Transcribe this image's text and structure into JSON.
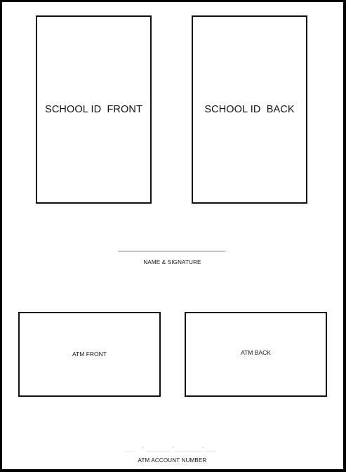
{
  "id_section": {
    "front_label": "SCHOOL ID  FRONT",
    "back_label": "SCHOOL ID  BACK"
  },
  "signature": {
    "label": "NAME & SIGNATURE"
  },
  "atm_section": {
    "front_label": "ATM FRONT",
    "back_label": "ATM BACK"
  },
  "account": {
    "placeholder_line": "__ -_____-_____-__",
    "label": "ATM ACCOUNT NUMBER"
  }
}
